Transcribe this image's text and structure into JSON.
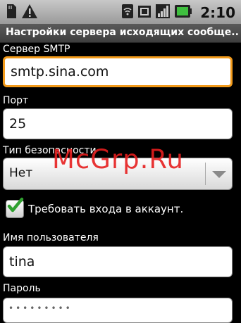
{
  "status_bar": {
    "icons_left": [
      "sd-card-icon",
      "warning-icon"
    ],
    "icons_right": [
      "wifi-icon",
      "sync-icon",
      "signal-icon",
      "battery-icon"
    ],
    "time": "2:10"
  },
  "title": "Настройки сервера исходящих сообще...",
  "form": {
    "smtp": {
      "label": "Сервер SMTP",
      "value": "smtp.sina.com"
    },
    "port": {
      "label": "Порт",
      "value": "25"
    },
    "security": {
      "label": "Тип безопасности",
      "value": "Нет"
    },
    "require_login": {
      "label": "Требовать входа в аккаунт.",
      "checked": true
    },
    "username": {
      "label": "Имя пользователя",
      "value": "tina"
    },
    "password": {
      "label": "Пароль",
      "value": "•••••••••"
    }
  },
  "watermark": "McGrp.Ru",
  "colors": {
    "focus": "#f29a1a",
    "check": "#2fa02f",
    "watermark": "#e61e1e"
  }
}
